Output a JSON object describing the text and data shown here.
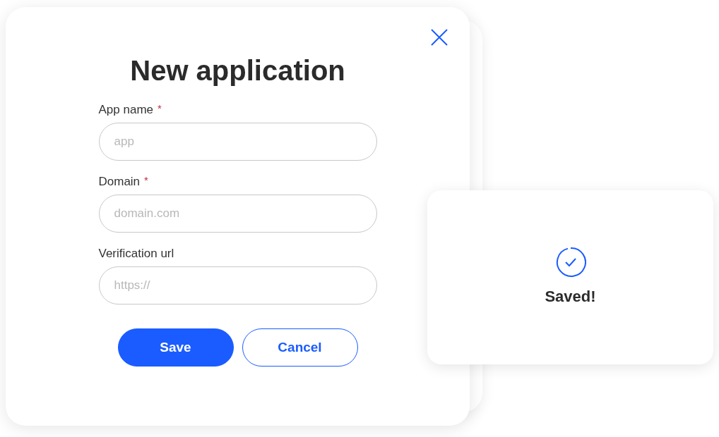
{
  "dialog": {
    "title": "New application",
    "fields": [
      {
        "label": "App name",
        "required_mark": "*",
        "placeholder": "app"
      },
      {
        "label": "Domain",
        "required_mark": "*",
        "placeholder": "domain.com"
      },
      {
        "label": "Verification url",
        "placeholder": "https://"
      }
    ],
    "buttons": [
      {
        "label": "Save",
        "kind": "primary"
      },
      {
        "label": "Cancel",
        "kind": "secondary"
      }
    ]
  },
  "toast": {
    "message": "Saved!"
  }
}
